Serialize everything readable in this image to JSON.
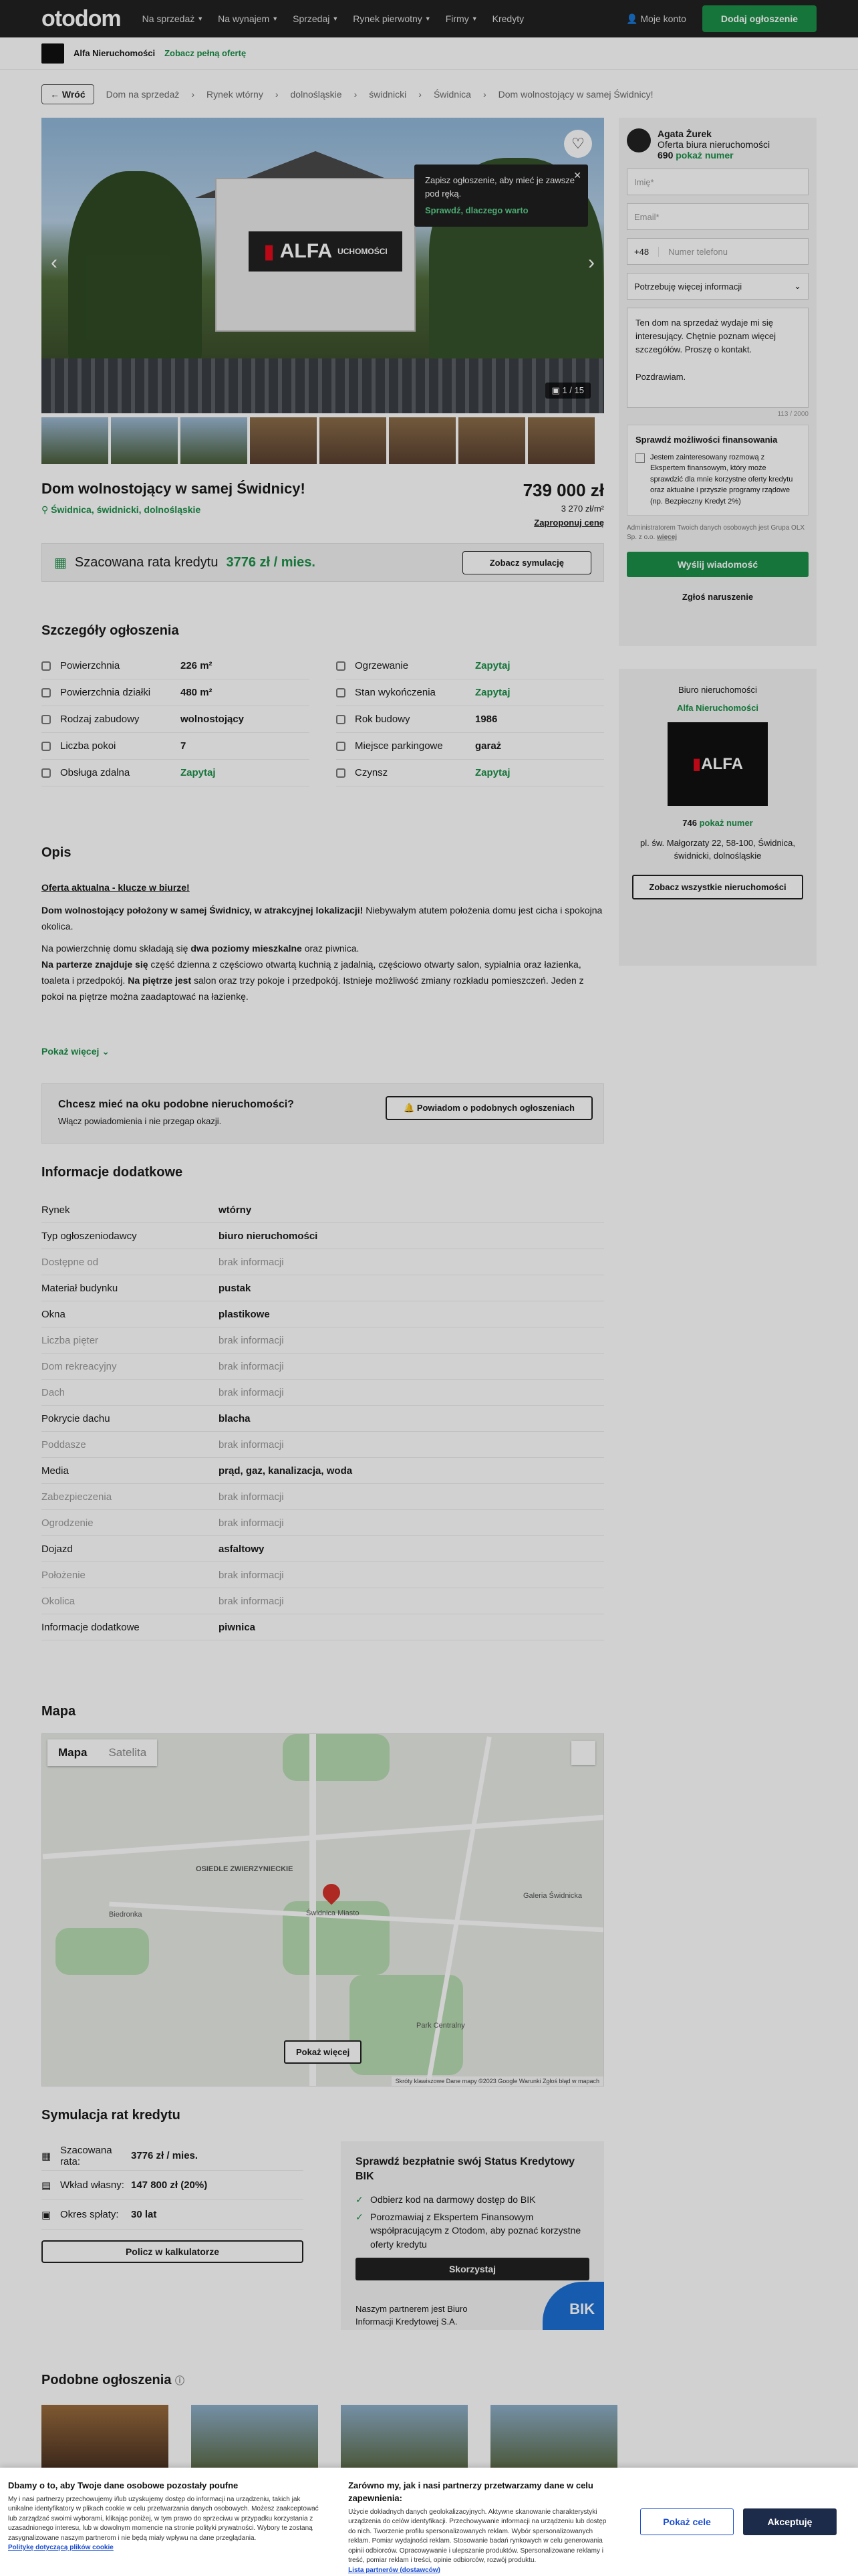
{
  "nav": {
    "logo": "otodom",
    "links": [
      "Na sprzedaż",
      "Na wynajem",
      "Sprzedaj",
      "Rynek pierwotny",
      "Firmy",
      "Kredyty"
    ],
    "account": "Moje konto",
    "add_listing": "Dodaj ogłoszenie"
  },
  "agency_bar": {
    "name": "Alfa Nieruchomości",
    "link": "Zobacz pełną ofertę"
  },
  "breadcrumb": {
    "back": "Wróć",
    "items": [
      "Dom na sprzedaż",
      "Rynek wtórny",
      "dolnośląskie",
      "świdnicki",
      "Świdnica",
      "Dom wolnostojący w samej Świdnicy!"
    ]
  },
  "gallery": {
    "sign_text": "ALFA",
    "sign_sub": "UCHOMOŚCI",
    "tooltip_text": "Zapisz ogłoszenie, aby mieć je zawsze pod ręką.",
    "tooltip_link": "Sprawdź, dlaczego warto",
    "counter": "1 / 15"
  },
  "listing": {
    "title": "Dom wolnostojący w samej Świdnicy!",
    "address": "Świdnica, świdnicki, dolnośląskie",
    "price": "739 000 zł",
    "price_m2": "3 270 zł/m²",
    "propose": "Zaproponuj cenę"
  },
  "credit": {
    "label": "Szacowana rata kredytu",
    "value": "3776 zł / mies.",
    "button": "Zobacz symulację"
  },
  "details_title": "Szczegóły ogłoszenia",
  "details": [
    {
      "k": "Powierzchnia",
      "v": "226 m²",
      "green": false
    },
    {
      "k": "Ogrzewanie",
      "v": "Zapytaj",
      "green": true
    },
    {
      "k": "Powierzchnia działki",
      "v": "480 m²",
      "green": false
    },
    {
      "k": "Stan wykończenia",
      "v": "Zapytaj",
      "green": true
    },
    {
      "k": "Rodzaj zabudowy",
      "v": "wolnostojący",
      "green": false
    },
    {
      "k": "Rok budowy",
      "v": "1986",
      "green": false
    },
    {
      "k": "Liczba pokoi",
      "v": "7",
      "green": false
    },
    {
      "k": "Miejsce parkingowe",
      "v": "garaż",
      "green": false
    },
    {
      "k": "Obsługa zdalna",
      "v": "Zapytaj",
      "green": true
    },
    {
      "k": "Czynsz",
      "v": "Zapytaj",
      "green": true
    }
  ],
  "description": {
    "title": "Opis",
    "line1": "Oferta aktualna - klucze w biurze!",
    "p1_bold": "Dom wolnostojący położony w samej Świdnicy, w atrakcyjnej lokalizacji!",
    "p1_rest": " Niebywałym atutem położenia domu jest cicha i spokojna okolica.",
    "p2_a": "Na powierzchnię domu składają się ",
    "p2_b": "dwa poziomy mieszkalne",
    "p2_c": " oraz piwnica.",
    "p3_a": "Na parterze znajduje się",
    "p3_b": " część dzienna z częściowo otwartą kuchnią z jadalnią, częściowo otwarty salon, sypialnia oraz łazienka, toaleta i przedpokój. ",
    "p3_c": "Na piętrze jest",
    "p3_d": " salon oraz trzy pokoje i przedpokój. Istnieje możliwość zmiany rozkładu pomieszczeń. Jeden z pokoi na piętrze można zaadaptować na łazienkę.",
    "more": "Pokaż więcej"
  },
  "notify": {
    "title": "Chcesz mieć na oku podobne nieruchomości?",
    "sub": "Włącz powiadomienia i nie przegap okazji.",
    "button": "Powiadom o podobnych ogłoszeniach"
  },
  "info_title": "Informacje dodatkowe",
  "info": [
    {
      "k": "Rynek",
      "v": "wtórny",
      "na": false
    },
    {
      "k": "Typ ogłoszeniodawcy",
      "v": "biuro nieruchomości",
      "na": false
    },
    {
      "k": "Dostępne od",
      "v": "brak informacji",
      "na": true
    },
    {
      "k": "Materiał budynku",
      "v": "pustak",
      "na": false
    },
    {
      "k": "Okna",
      "v": "plastikowe",
      "na": false
    },
    {
      "k": "Liczba pięter",
      "v": "brak informacji",
      "na": true
    },
    {
      "k": "Dom rekreacyjny",
      "v": "brak informacji",
      "na": true
    },
    {
      "k": "Dach",
      "v": "brak informacji",
      "na": true
    },
    {
      "k": "Pokrycie dachu",
      "v": "blacha",
      "na": false
    },
    {
      "k": "Poddasze",
      "v": "brak informacji",
      "na": true
    },
    {
      "k": "Media",
      "v": "prąd, gaz, kanalizacja, woda",
      "na": false
    },
    {
      "k": "Zabezpieczenia",
      "v": "brak informacji",
      "na": true
    },
    {
      "k": "Ogrodzenie",
      "v": "brak informacji",
      "na": true
    },
    {
      "k": "Dojazd",
      "v": "asfaltowy",
      "na": false
    },
    {
      "k": "Położenie",
      "v": "brak informacji",
      "na": true
    },
    {
      "k": "Okolica",
      "v": "brak informacji",
      "na": true
    },
    {
      "k": "Informacje dodatkowe",
      "v": "piwnica",
      "na": false
    }
  ],
  "map": {
    "title": "Mapa",
    "tab_map": "Mapa",
    "tab_sat": "Satelita",
    "more": "Pokaż więcej",
    "labels": [
      "OSIEDLE ZWIERZYNIECKIE",
      "Galeria Świdnicka",
      "Park Centralny",
      "Biedronka",
      "Świdnica Miasto"
    ],
    "footer": "Skróty klawiszowe   Dane mapy ©2023 Google   Warunki   Zgłoś błąd w mapach"
  },
  "loan": {
    "title": "Symulacja rat kredytu",
    "rows": [
      {
        "k": "Szacowana rata:",
        "v": "3776 zł / mies."
      },
      {
        "k": "Wkład własny:",
        "v": "147 800 zł (20%)"
      },
      {
        "k": "Okres spłaty:",
        "v": "30 lat"
      }
    ],
    "button": "Policz w kalkulatorze",
    "bik_title": "Sprawdź bezpłatnie swój Status Kredytowy BIK",
    "bik_items": [
      "Odbierz kod na darmowy dostęp do BIK",
      "Porozmawiaj z Ekspertem Finansowym współpracującym z Otodom, aby poznać korzystne oferty kredytu"
    ],
    "bik_button": "Skorzystaj",
    "bik_partner": "Naszym partnerem jest Biuro Informacji Kredytowej S.A.",
    "bik_logo": "BIK"
  },
  "similar_title": "Podobne ogłoszenia",
  "contact": {
    "agent_name": "Agata Żurek",
    "agent_role": "Oferta biura nieruchomości",
    "phone_part": "690",
    "show_number": "pokaż numer",
    "name_ph": "Imię*",
    "email_ph": "Email*",
    "country_code": "+48",
    "phone_ph": "Numer telefonu",
    "select": "Potrzebuję więcej informacji",
    "message": "Ten dom na sprzedaż wydaje mi się interesujący. Chętnie poznam więcej szczegółów. Proszę o kontakt.",
    "greeting": "Pozdrawiam.",
    "counter": "113 / 2000",
    "fin_title": "Sprawdź możliwości finansowania",
    "fin_text": "Jestem zainteresowany rozmową z Ekspertem finansowym, który może sprawdzić dla mnie korzystne oferty kredytu oraz aktualne i przyszłe programy rządowe (np. Bezpieczny Kredyt 2%)",
    "admin": "Administratorem Twoich danych osobowych jest Grupa OLX Sp. z o.o.",
    "admin_more": "więcej",
    "send": "Wyślij wiadomość",
    "report": "Zgłoś naruszenie"
  },
  "agency_card": {
    "label": "Biuro nieruchomości",
    "name": "Alfa Nieruchomości",
    "logo": "ALFA",
    "phone_part": "746",
    "show_number": "pokaż numer",
    "address": "pl. św. Małgorzaty 22, 58-100, Świdnica, świdnicki, dolnośląskie",
    "button": "Zobacz wszystkie nieruchomości"
  },
  "cookie": {
    "left_title": "Dbamy o to, aby Twoje dane osobowe pozostały poufne",
    "left_text": "My i nasi partnerzy przechowujemy i/lub uzyskujemy dostęp do informacji na urządzeniu, takich jak unikalne identyfikatory w plikach cookie w celu przetwarzania danych osobowych. Możesz zaakceptować lub zarządzać swoimi wyborami, klikając poniżej, w tym prawo do sprzeciwu w przypadku korzystania z uzasadnionego interesu, lub w dowolnym momencie na stronie polityki prywatności. Wybory te zostaną zasygnalizowane naszym partnerom i nie będą miały wpływu na dane przeglądania.",
    "left_link": "Politykę dotyczącą plików cookie",
    "right_title": "Zarówno my, jak i nasi partnerzy przetwarzamy dane w celu zapewnienia:",
    "right_text": "Użycie dokładnych danych geolokalizacyjnych. Aktywne skanowanie charakterystyki urządzenia do celów identyfikacji. Przechowywanie informacji na urządzeniu lub dostęp do nich. Tworzenie profilu spersonalizowanych reklam. Wybór spersonalizowanych reklam. Pomiar wydajności reklam. Stosowanie badań rynkowych w celu generowania opinii odbiorców. Opracowywanie i ulepszanie produktów. Spersonalizowane reklamy i treść, pomiar reklam i treści, opinie odbiorców, rozwój produktu.",
    "right_link": "Lista partnerów (dostawców)",
    "btn_more": "Pokaż cele",
    "btn_accept": "Akceptuję"
  }
}
